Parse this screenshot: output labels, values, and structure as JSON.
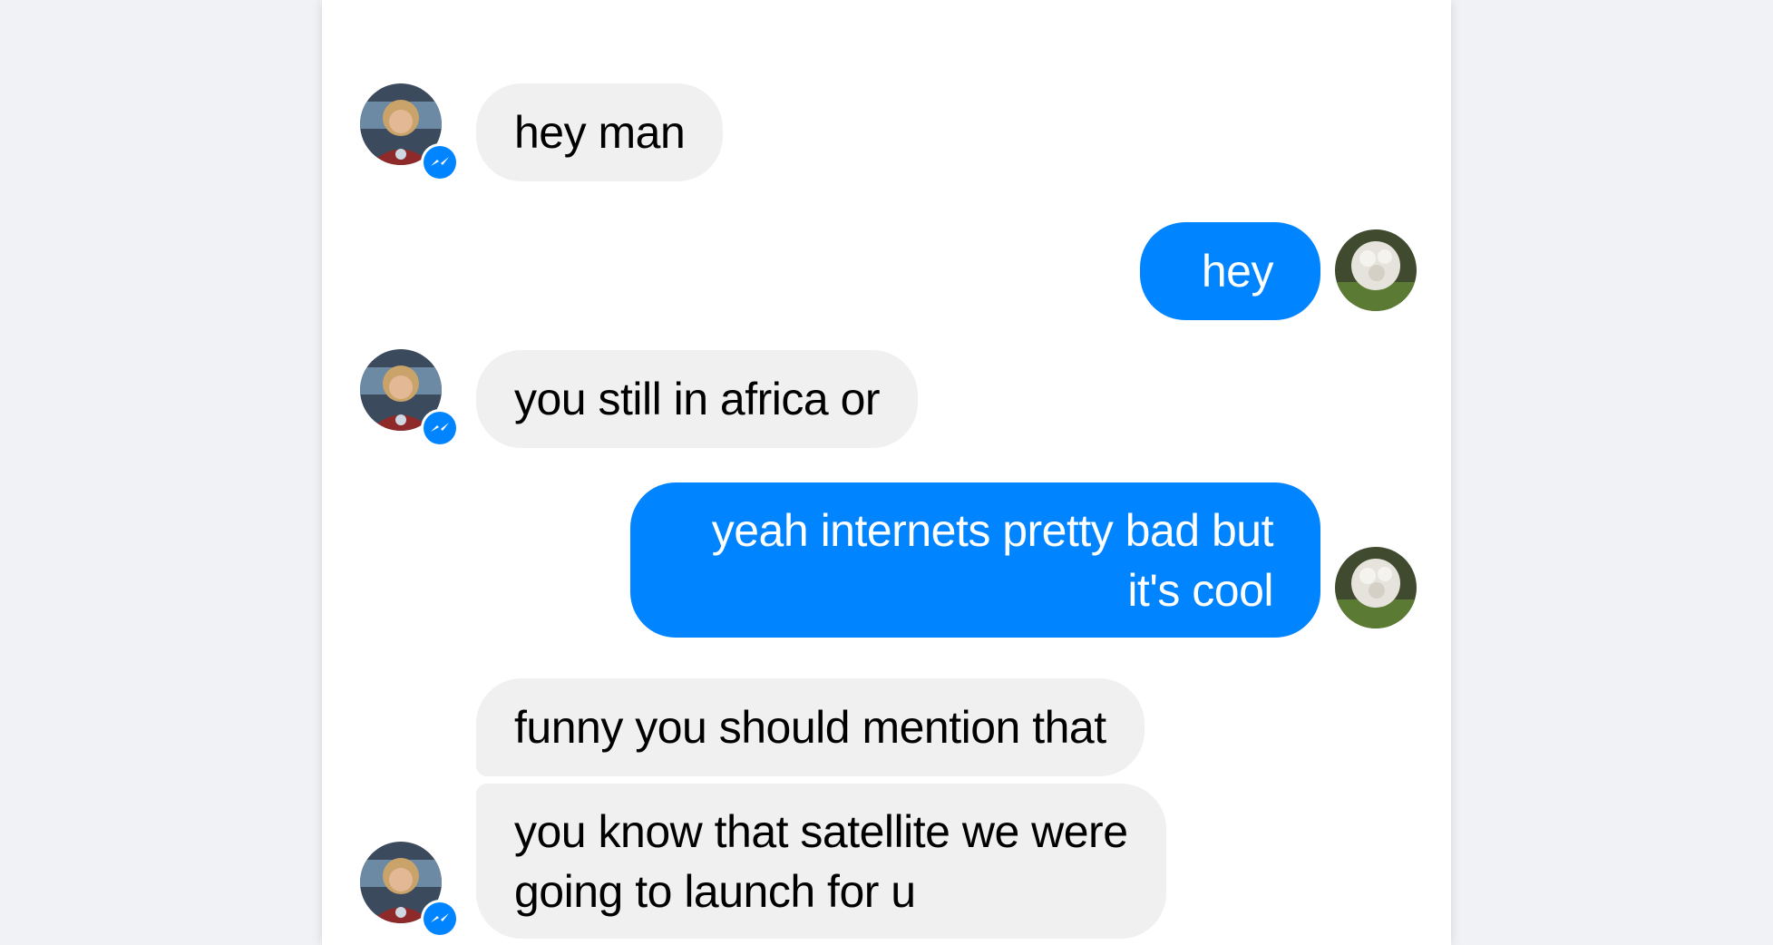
{
  "colors": {
    "page_background": "#f1f2f6",
    "panel_background": "#ffffff",
    "incoming_bubble": "#f1f0f0",
    "outgoing_bubble": "#0084ff",
    "messenger_badge": "#0084ff"
  },
  "conversation": {
    "messages": [
      {
        "direction": "incoming",
        "text": "hey man",
        "avatar": "contact-avatar"
      },
      {
        "direction": "outgoing",
        "text": "hey",
        "avatar": "self-avatar"
      },
      {
        "direction": "incoming",
        "text": "you still in africa or",
        "avatar": "contact-avatar"
      },
      {
        "direction": "outgoing",
        "lines": [
          "yeah internets pretty bad but",
          "it's cool"
        ],
        "avatar": "self-avatar"
      },
      {
        "direction": "incoming",
        "text": "funny you should mention that"
      },
      {
        "direction": "incoming",
        "lines": [
          "you know that satellite we were",
          "going to launch for u"
        ],
        "avatar": "contact-avatar"
      }
    ]
  },
  "icons": {
    "messenger_badge": "messenger-badge-icon",
    "contact_avatar": "contact-avatar-photo",
    "self_avatar": "self-avatar-photo"
  }
}
